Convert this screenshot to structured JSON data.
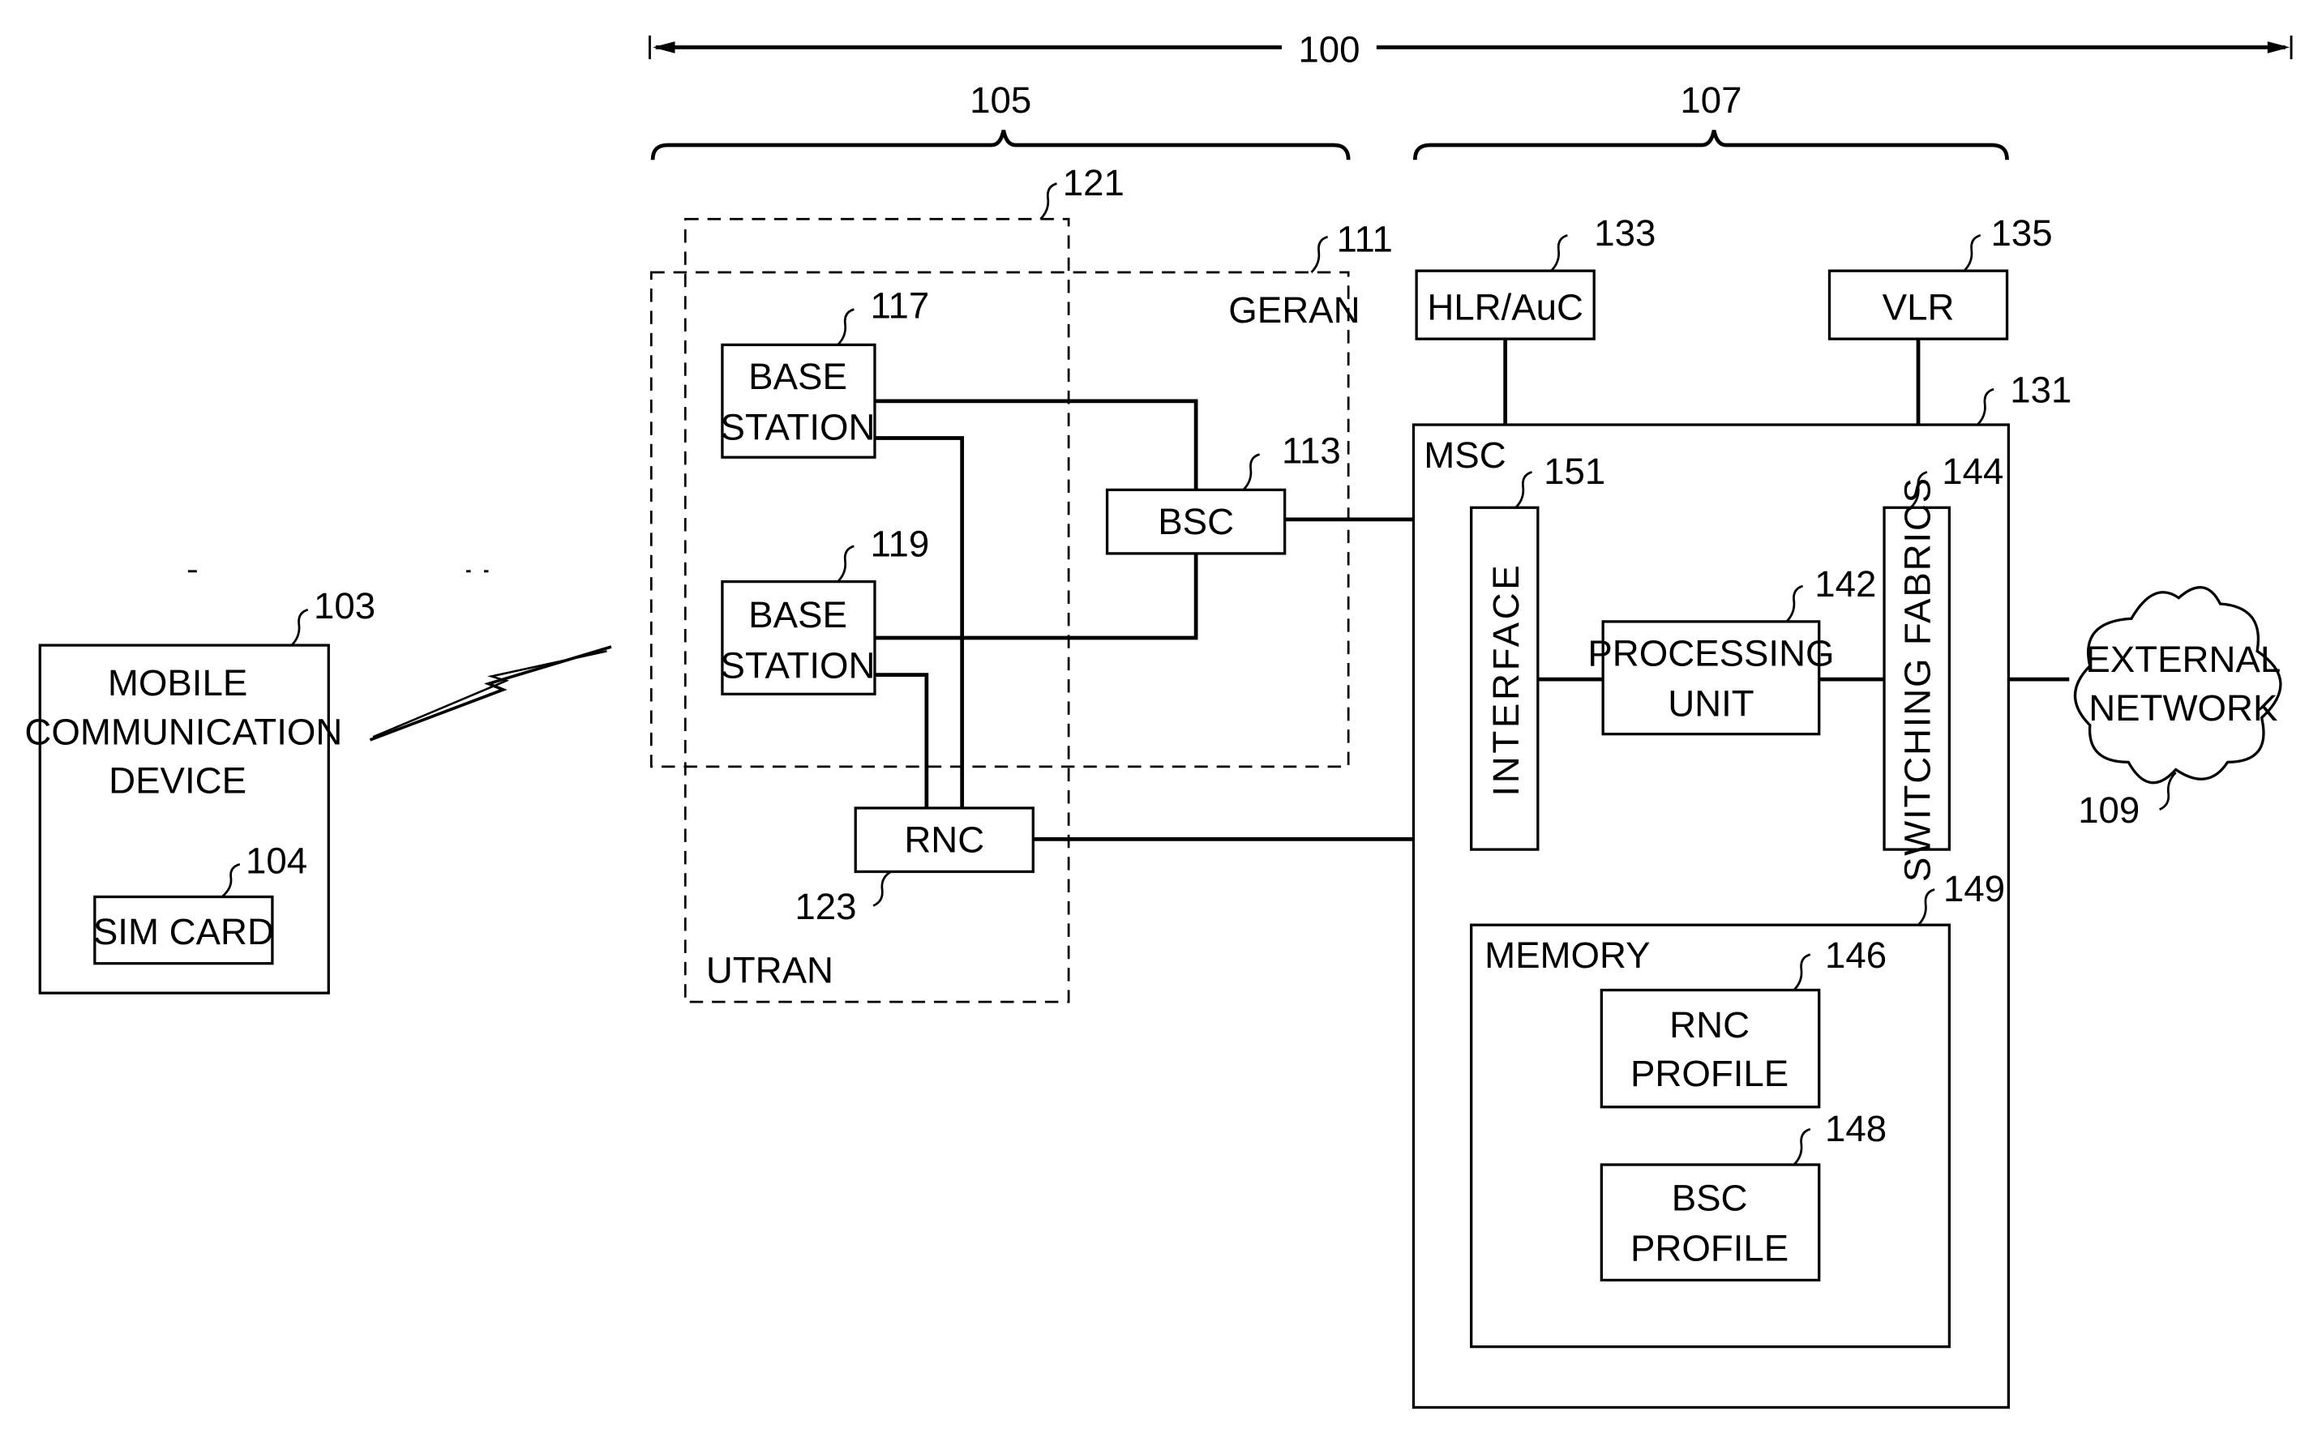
{
  "figure": {
    "system_ref": "100",
    "access_network_ref": "105",
    "core_network_ref": "107"
  },
  "mobile_device": {
    "ref": "103",
    "label_lines": [
      "MOBILE",
      "COMMUNICATION",
      "DEVICE"
    ],
    "sim": {
      "ref": "104",
      "label": "SIM  CARD"
    }
  },
  "geran": {
    "ref": "111",
    "label": "GERAN"
  },
  "utran": {
    "ref": "121",
    "label": "UTRAN"
  },
  "base_station_1": {
    "ref": "117",
    "label_lines": [
      "BASE",
      "STATION"
    ]
  },
  "base_station_2": {
    "ref": "119",
    "label_lines": [
      "BASE",
      "STATION"
    ]
  },
  "bsc": {
    "ref": "113",
    "label": "BSC"
  },
  "rnc": {
    "ref": "123",
    "label": "RNC"
  },
  "hlr": {
    "ref": "133",
    "label": "HLR/AuC"
  },
  "vlr": {
    "ref": "135",
    "label": "VLR"
  },
  "msc": {
    "ref": "131",
    "label": "MSC",
    "interface": {
      "ref": "151",
      "label": "INTERFACE"
    },
    "processing_unit": {
      "ref": "142",
      "label_lines": [
        "PROCESSING",
        "UNIT"
      ]
    },
    "switching_fabrics": {
      "ref": "144",
      "label": "SWITCHING  FABRICS"
    },
    "memory": {
      "ref": "149",
      "label": "MEMORY",
      "rnc_profile": {
        "ref": "146",
        "label_lines": [
          "RNC",
          "PROFILE"
        ]
      },
      "bsc_profile": {
        "ref": "148",
        "label_lines": [
          "BSC",
          "PROFILE"
        ]
      }
    }
  },
  "external_network": {
    "ref": "109",
    "label_lines": [
      "EXTERNAL",
      "NETWORK"
    ]
  }
}
